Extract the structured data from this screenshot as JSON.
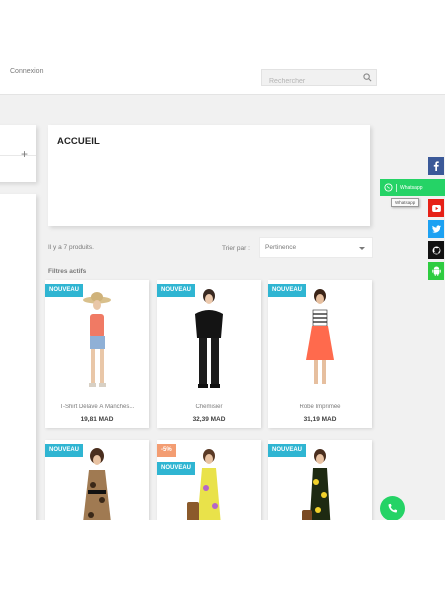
{
  "header": {
    "account_text": "Connexion",
    "search_placeholder": "Rechercher"
  },
  "home": {
    "title": "ACCUEIL"
  },
  "listing": {
    "count_text": "Il y a 7 produits.",
    "sort_label": "Trier par :",
    "sort_value": "Pertinence",
    "filters_title": "Filtres actifs"
  },
  "products": [
    {
      "name": "T-Shirt Délavé À Manches...",
      "price": "19,81 MAD",
      "flags": [
        "NOUVEAU"
      ]
    },
    {
      "name": "Chemisier",
      "price": "32,39 MAD",
      "flags": [
        "NOUVEAU"
      ]
    },
    {
      "name": "Robe Imprimée",
      "price": "31,19 MAD",
      "flags": [
        "NOUVEAU"
      ]
    },
    {
      "name": "",
      "price": "",
      "flags": [
        "NOUVEAU"
      ]
    },
    {
      "name": "",
      "price": "",
      "flags": [
        "-5%",
        "NOUVEAU"
      ]
    },
    {
      "name": "",
      "price": "",
      "flags": [
        "NOUVEAU"
      ]
    }
  ],
  "floating": {
    "whatsapp_label": "Whatsapp",
    "whatsapp_tooltip": "Whatsapp",
    "social_icons": [
      "facebook-icon",
      "youtube-icon",
      "twitter-icon",
      "github-icon",
      "android-icon"
    ],
    "call_icon": "phone-icon"
  },
  "colors": {
    "flag_new": "#2fb5d2",
    "flag_discount": "#f39d72",
    "whatsapp": "#25d366",
    "facebook": "#3b5998",
    "youtube": "#e62117",
    "twitter": "#1da1f2",
    "github": "#111111",
    "android": "#2ecc40"
  }
}
